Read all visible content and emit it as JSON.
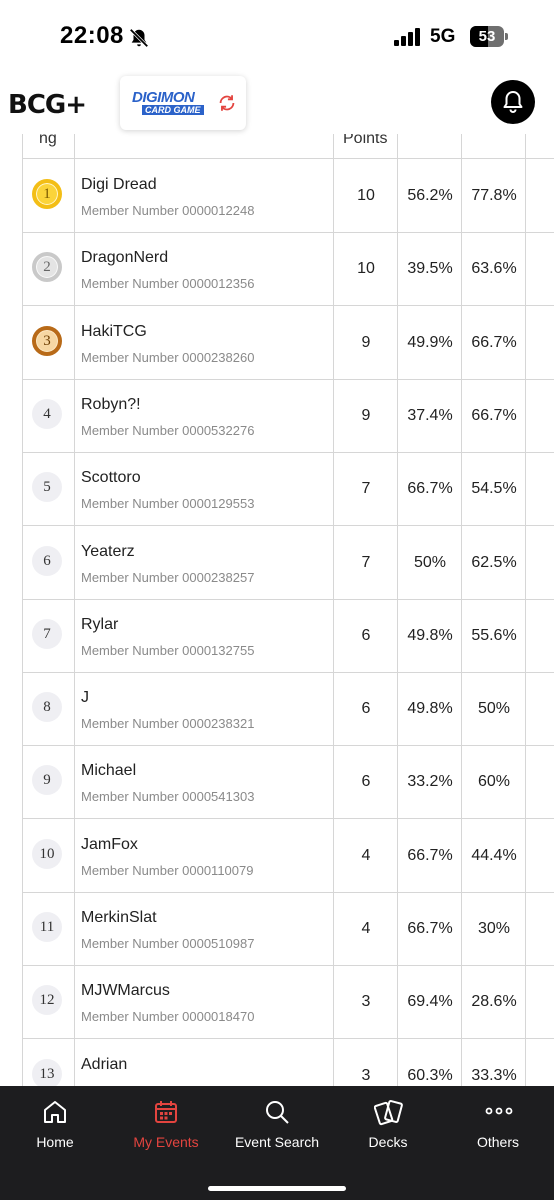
{
  "status_bar": {
    "time": "22:08",
    "network": "5G",
    "battery": "53"
  },
  "header": {
    "brand": "BCG+",
    "game_logo_line1": "DIGIMON",
    "game_logo_line2": "CARD GAME"
  },
  "table": {
    "headers": {
      "rank": "ng",
      "player": "",
      "points": "Points",
      "col4": "",
      "col5": ""
    },
    "rows": [
      {
        "rank": "1",
        "medal": "gold",
        "name": "Digi Dread",
        "member_number": "Member Number 0000012248",
        "points": "10",
        "omw": "56.2%",
        "gw": "77.8%"
      },
      {
        "rank": "2",
        "medal": "silver",
        "name": "DragonNerd",
        "member_number": "Member Number 0000012356",
        "points": "10",
        "omw": "39.5%",
        "gw": "63.6%"
      },
      {
        "rank": "3",
        "medal": "bronze",
        "name": "HakiTCG",
        "member_number": "Member Number 0000238260",
        "points": "9",
        "omw": "49.9%",
        "gw": "66.7%"
      },
      {
        "rank": "4",
        "medal": "none",
        "name": "Robyn?!",
        "member_number": "Member Number 0000532276",
        "points": "9",
        "omw": "37.4%",
        "gw": "66.7%"
      },
      {
        "rank": "5",
        "medal": "none",
        "name": "Scottoro",
        "member_number": "Member Number 0000129553",
        "points": "7",
        "omw": "66.7%",
        "gw": "54.5%"
      },
      {
        "rank": "6",
        "medal": "none",
        "name": "Yeaterz",
        "member_number": "Member Number 0000238257",
        "points": "7",
        "omw": "50%",
        "gw": "62.5%"
      },
      {
        "rank": "7",
        "medal": "none",
        "name": "Rylar",
        "member_number": "Member Number 0000132755",
        "points": "6",
        "omw": "49.8%",
        "gw": "55.6%"
      },
      {
        "rank": "8",
        "medal": "none",
        "name": "J",
        "member_number": "Member Number 0000238321",
        "points": "6",
        "omw": "49.8%",
        "gw": "50%"
      },
      {
        "rank": "9",
        "medal": "none",
        "name": "Michael",
        "member_number": "Member Number 0000541303",
        "points": "6",
        "omw": "33.2%",
        "gw": "60%"
      },
      {
        "rank": "10",
        "medal": "none",
        "name": "JamFox",
        "member_number": "Member Number 0000110079",
        "points": "4",
        "omw": "66.7%",
        "gw": "44.4%"
      },
      {
        "rank": "11",
        "medal": "none",
        "name": "MerkinSlat",
        "member_number": "Member Number 0000510987",
        "points": "4",
        "omw": "66.7%",
        "gw": "30%"
      },
      {
        "rank": "12",
        "medal": "none",
        "name": "MJWMarcus",
        "member_number": "Member Number 0000018470",
        "points": "3",
        "omw": "69.4%",
        "gw": "28.6%"
      },
      {
        "rank": "13",
        "medal": "none",
        "name": "Adrian",
        "member_number": "",
        "points": "3",
        "omw": "60.3%",
        "gw": "33.3%"
      }
    ]
  },
  "bottom_nav": {
    "items": [
      {
        "label": "Home",
        "icon": "home-icon",
        "active": false
      },
      {
        "label": "My Events",
        "icon": "calendar-icon",
        "active": true
      },
      {
        "label": "Event Search",
        "icon": "search-icon",
        "active": false
      },
      {
        "label": "Decks",
        "icon": "cards-icon",
        "active": false
      },
      {
        "label": "Others",
        "icon": "more-icon",
        "active": false
      }
    ]
  },
  "colors": {
    "accent": "#e3443f",
    "nav_bg": "#1d1d1f",
    "gold": "#fbd43a",
    "silver": "#c9c9c9",
    "bronze": "#b86a18"
  }
}
